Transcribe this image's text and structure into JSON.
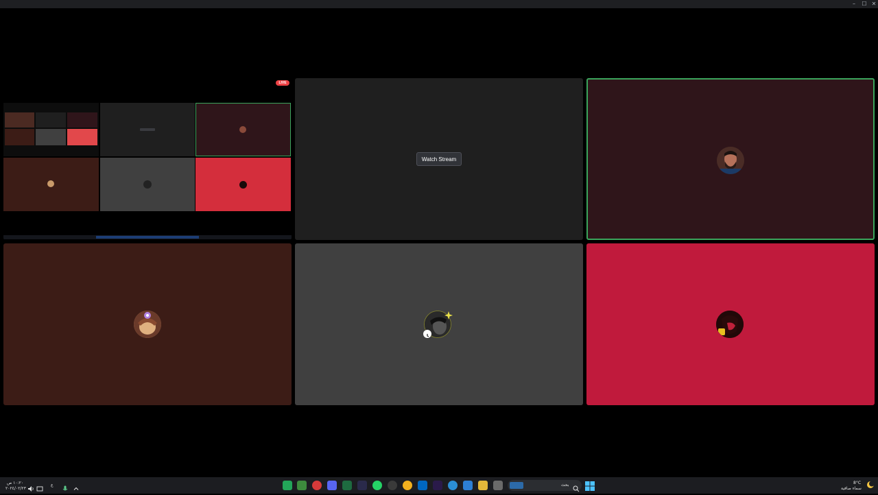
{
  "window": {
    "minimize_glyph": "–",
    "maximize_glyph": "☐",
    "close_glyph": "✕"
  },
  "stream": {
    "live_label": "LIVE",
    "watch_button_label": "Watch Stream"
  },
  "participants": [
    {
      "id": "p1",
      "tile_color": "#2f151a",
      "speaking": true,
      "icon": "bearded-man-avatar"
    },
    {
      "id": "p2",
      "tile_color": "#3c1c16",
      "speaking": false,
      "icon": "anime-character-avatar"
    },
    {
      "id": "p3",
      "tile_color": "#404040",
      "speaking": false,
      "icon": "dark-character-avatar"
    },
    {
      "id": "p4",
      "tile_color": "#c01a3c",
      "speaking": false,
      "icon": "red-character-avatar"
    }
  ],
  "colors": {
    "stream_tile": "#1f1f1f",
    "speaking_border": "#3ba55c",
    "live_red": "#ed4245",
    "taskbar": "#1c1d21"
  },
  "taskbar": {
    "clock_time": "١٠:٢٠ ص",
    "clock_date": "٢٠٢٤/٠٢/٢٣",
    "language_indicator": "ع",
    "search_placeholder": "بحث",
    "weather_temp": "8°C",
    "weather_desc": "سماء صافية",
    "pinned_apps": [
      "discord-icon",
      "paint-icon",
      "browser-icon",
      "discord-app-icon",
      "excel-icon",
      "pen-icon",
      "whatsapp-icon",
      "settings-icon",
      "chrome-icon",
      "store-icon",
      "edge-icon",
      "premiere-icon",
      "photos-icon",
      "file-explorer-icon",
      "files-icon"
    ]
  }
}
